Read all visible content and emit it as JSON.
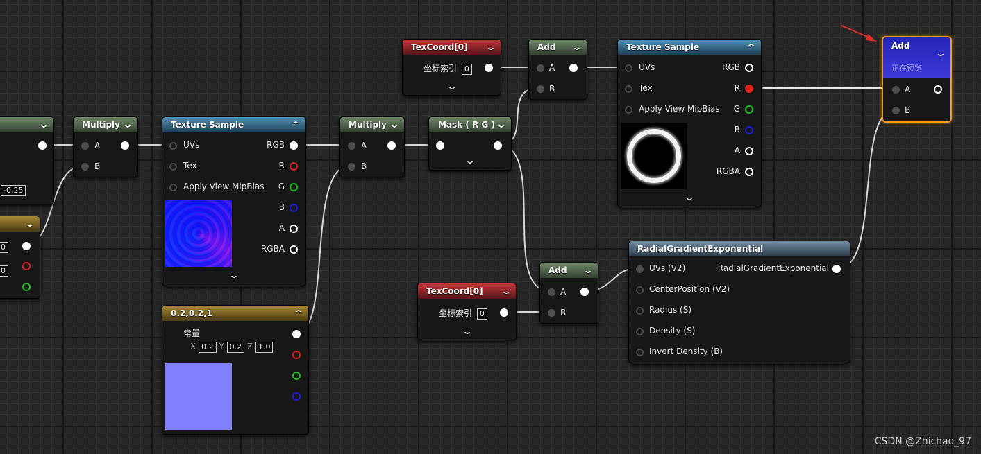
{
  "nodes": {
    "left_partial": {
      "value": "-0.25"
    },
    "left_const": {
      "v1": "0",
      "v2": "0"
    },
    "multiply1": {
      "title": "Multiply",
      "pin_a": "A",
      "pin_b": "B"
    },
    "texsample1": {
      "title": "Texture Sample",
      "in_uvs": "UVs",
      "in_tex": "Tex",
      "in_mip": "Apply View MipBias",
      "out_rgb": "RGB",
      "out_r": "R",
      "out_g": "G",
      "out_b": "B",
      "out_a": "A",
      "out_rgba": "RGBA"
    },
    "const3": {
      "title": "0.2,0.2,1",
      "label": "常量",
      "x_label": "X",
      "x": "0.2",
      "y_label": "Y",
      "y": "0.2",
      "z_label": "Z",
      "z": "1.0"
    },
    "multiply2": {
      "title": "Multiply",
      "pin_a": "A",
      "pin_b": "B"
    },
    "mask": {
      "title": "Mask ( R G )"
    },
    "texcoord1": {
      "title": "TexCoord[0]",
      "label": "坐标索引",
      "value": "0"
    },
    "add1": {
      "title": "Add",
      "pin_a": "A",
      "pin_b": "B"
    },
    "texsample2": {
      "title": "Texture Sample",
      "in_uvs": "UVs",
      "in_tex": "Tex",
      "in_mip": "Apply View MipBias",
      "out_rgb": "RGB",
      "out_r": "R",
      "out_g": "G",
      "out_b": "B",
      "out_a": "A",
      "out_rgba": "RGBA"
    },
    "add_final": {
      "title": "Add",
      "subtitle": "正在预览",
      "pin_a": "A",
      "pin_b": "B"
    },
    "texcoord2": {
      "title": "TexCoord[0]",
      "label": "坐标索引",
      "value": "0"
    },
    "add2": {
      "title": "Add",
      "pin_a": "A",
      "pin_b": "B"
    },
    "radial": {
      "title": "RadialGradientExponential",
      "in_uvs": "UVs (V2)",
      "in_center": "CenterPosition (V2)",
      "in_radius": "Radius (S)",
      "in_density": "Density (S)",
      "in_invert": "Invert Density (B)",
      "out": "RadialGradientExponential"
    }
  },
  "colors": {
    "accent_selected": "#f39b12",
    "arrow": "#e0302a",
    "wire": "#d8d8d8",
    "wire_red": "#e02020"
  },
  "watermark": "CSDN @Zhichao_97"
}
